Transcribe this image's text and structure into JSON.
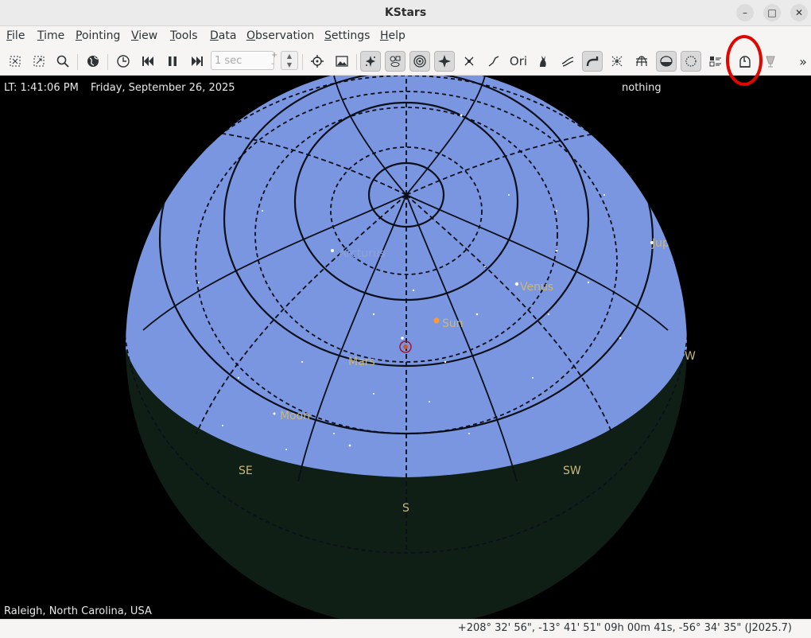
{
  "window": {
    "title": "KStars",
    "minimize": "–",
    "maximize": "□",
    "close": "✕"
  },
  "menu": [
    {
      "pre": "",
      "ul": "F",
      "post": "ile"
    },
    {
      "pre": "",
      "ul": "T",
      "post": "ime"
    },
    {
      "pre": "",
      "ul": "P",
      "post": "ointing"
    },
    {
      "pre": "",
      "ul": "V",
      "post": "iew"
    },
    {
      "pre": "",
      "ul": "T",
      "post": "ools"
    },
    {
      "pre": "",
      "ul": "D",
      "post": "ata"
    },
    {
      "pre": "",
      "ul": "O",
      "post": "bservation"
    },
    {
      "pre": "",
      "ul": "S",
      "post": "ettings"
    },
    {
      "pre": "",
      "ul": "H",
      "post": "elp"
    }
  ],
  "toolbar": {
    "timestep_value": "1 sec",
    "overflow": "»"
  },
  "sky": {
    "local_time": "LT: 1:41:06 PM",
    "date": "Friday, September 26, 2025",
    "focus_object": "nothing",
    "location": "Raleigh, North Carolina, USA",
    "labels": {
      "arcturus": "Arcturus",
      "jupiter": "Jupiter",
      "venus": "Venus",
      "sun": "Sun",
      "mars": "Mars",
      "moon": "Moon",
      "se": "SE",
      "s": "S",
      "sw": "SW",
      "w": "W"
    },
    "colors": {
      "sky": "#7b96e0",
      "ground": "#0f1f16",
      "label": "#c9b77a",
      "grid": "#0a0f1a"
    }
  },
  "status": {
    "coords": "+208° 32' 56\", -13° 41' 51\"  09h 00m 41s, -56° 34' 35\" (J2025.7)"
  }
}
